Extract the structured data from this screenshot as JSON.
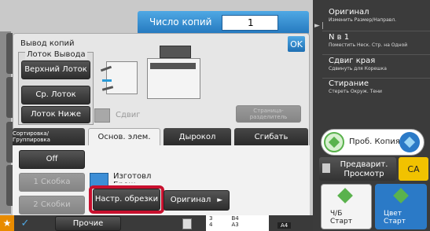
{
  "header": {
    "copies_label": "Число копий",
    "copies_value": "1"
  },
  "left_panel": {
    "output_title": "Вывод копий",
    "tray_title": "Лоток Вывода",
    "trays": [
      "Верхний Лоток",
      "Ср. Лоток",
      "Лоток Ниже"
    ],
    "shift_label": "Сдвиг",
    "ok_label": "OK",
    "separator_label": "Страница-разделитель"
  },
  "tabs": [
    "Сортировка/Группировка",
    "Основ. элем.",
    "Дырокол",
    "Сгибать"
  ],
  "options": {
    "off": "Off",
    "staple1": "1 Скобка",
    "staple2": "2 Скобки"
  },
  "booklet_label": "Изготовл Брош.",
  "trim_label": "Настр. обрезки",
  "original_label": "Оригинал",
  "right_panel": [
    {
      "title": "Оригинал",
      "sub": "Изменить Размер/Направл."
    },
    {
      "title": "N в 1",
      "sub": "Поместить Неск. Стр. на Одной"
    },
    {
      "title": "Сдвиг края",
      "sub": "Сдвинуть для Корешка"
    },
    {
      "title": "Стирание",
      "sub": "Стереть Окруж. Тени"
    }
  ],
  "proof_label": "Проб. Копия",
  "preview_label": "Предварит. Просмотр",
  "ca_label": "CA",
  "bw_start": "Ч/Б Старт",
  "color_start": "Цвет Старт",
  "bottom": {
    "other_label": "Прочие",
    "sizes": [
      "3",
      "4"
    ],
    "paper": [
      "B4",
      "A3"
    ],
    "a4": "A4"
  }
}
